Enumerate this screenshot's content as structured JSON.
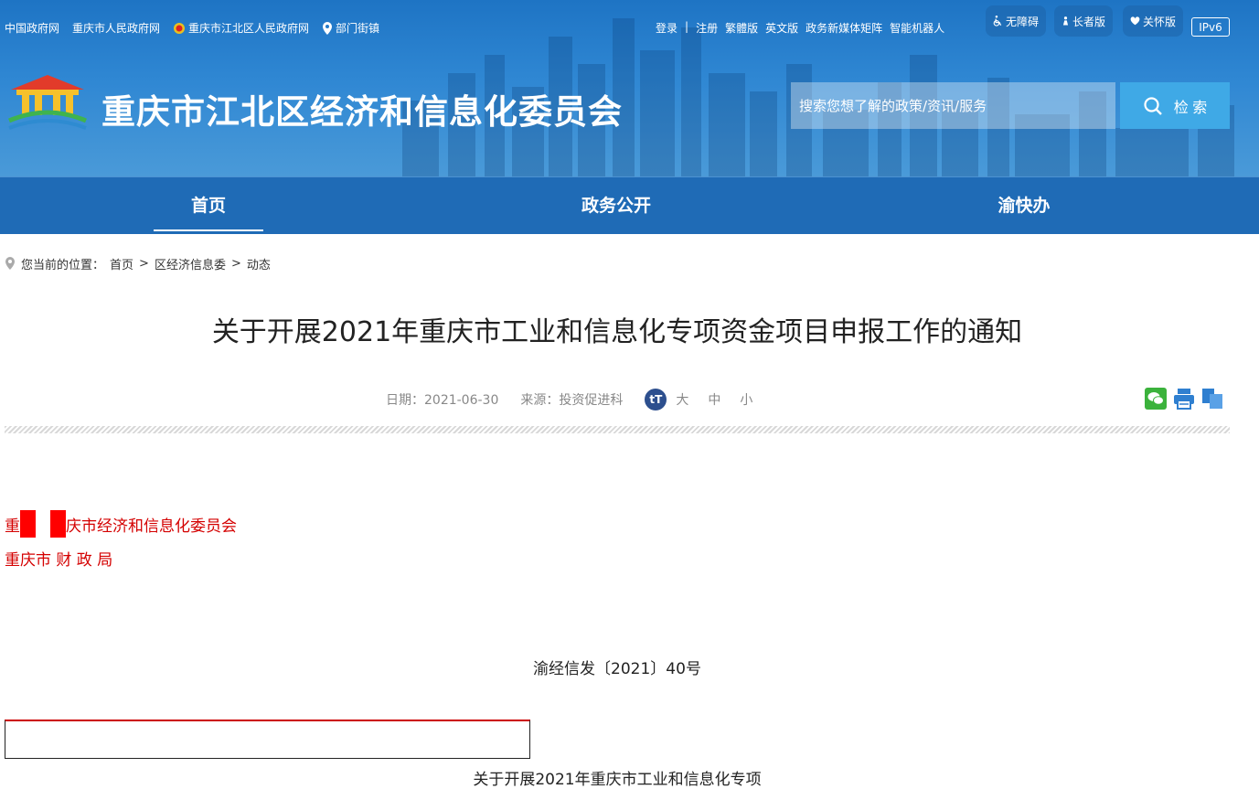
{
  "header": {
    "top_links": [
      "中国政府网",
      "重庆市人民政府网",
      "重庆市江北区人民政府网",
      "部门街镇"
    ],
    "right_links": [
      "登录",
      "|",
      "注册",
      "繁體版",
      "英文版",
      "政务新媒体矩阵",
      "智能机器人"
    ],
    "accessibility": [
      "无障碍",
      "长者版",
      "关怀版"
    ],
    "ipv6": "IPv6",
    "site_title": "重庆市江北区经济和信息化委员会",
    "search_placeholder": "搜索您想了解的政策/资讯/服务",
    "search_button": "检 索"
  },
  "nav": {
    "items": [
      "首页",
      "政务公开",
      "渝快办"
    ],
    "active": "首页"
  },
  "breadcrumb": {
    "label": "您当前的位置：",
    "path": [
      "首页",
      ">",
      "区经济信息委",
      ">",
      "动态"
    ]
  },
  "article": {
    "title": "关于开展2021年重庆市工业和信息化专项资金项目申报工作的通知",
    "date_label": "日期：",
    "date": "2021-06-30",
    "source_label": "来源：",
    "source": "投资促进科",
    "font_icon": "tT",
    "font_sizes": [
      "大",
      "中",
      "小"
    ],
    "issuer_line1_start": "重",
    "issuer_line1_end": "庆市经济和信息化委员会",
    "issuer_line2": "重庆市 财 政 局",
    "doc_number": "渝经信发〔2021〕40号",
    "subtitle": "关于开展2021年重庆市工业和信息化专项"
  },
  "colors": {
    "header_blue": "#1e74c4",
    "nav_blue": "#1f6bb6",
    "search_button": "#3fa9e6",
    "issuer_red": "#d40000"
  },
  "icons": [
    "location-pin-icon",
    "wheelchair-icon",
    "elder-icon",
    "heart-icon",
    "search-icon",
    "wechat-icon",
    "print-icon",
    "copy-icon",
    "font-size-icon"
  ]
}
